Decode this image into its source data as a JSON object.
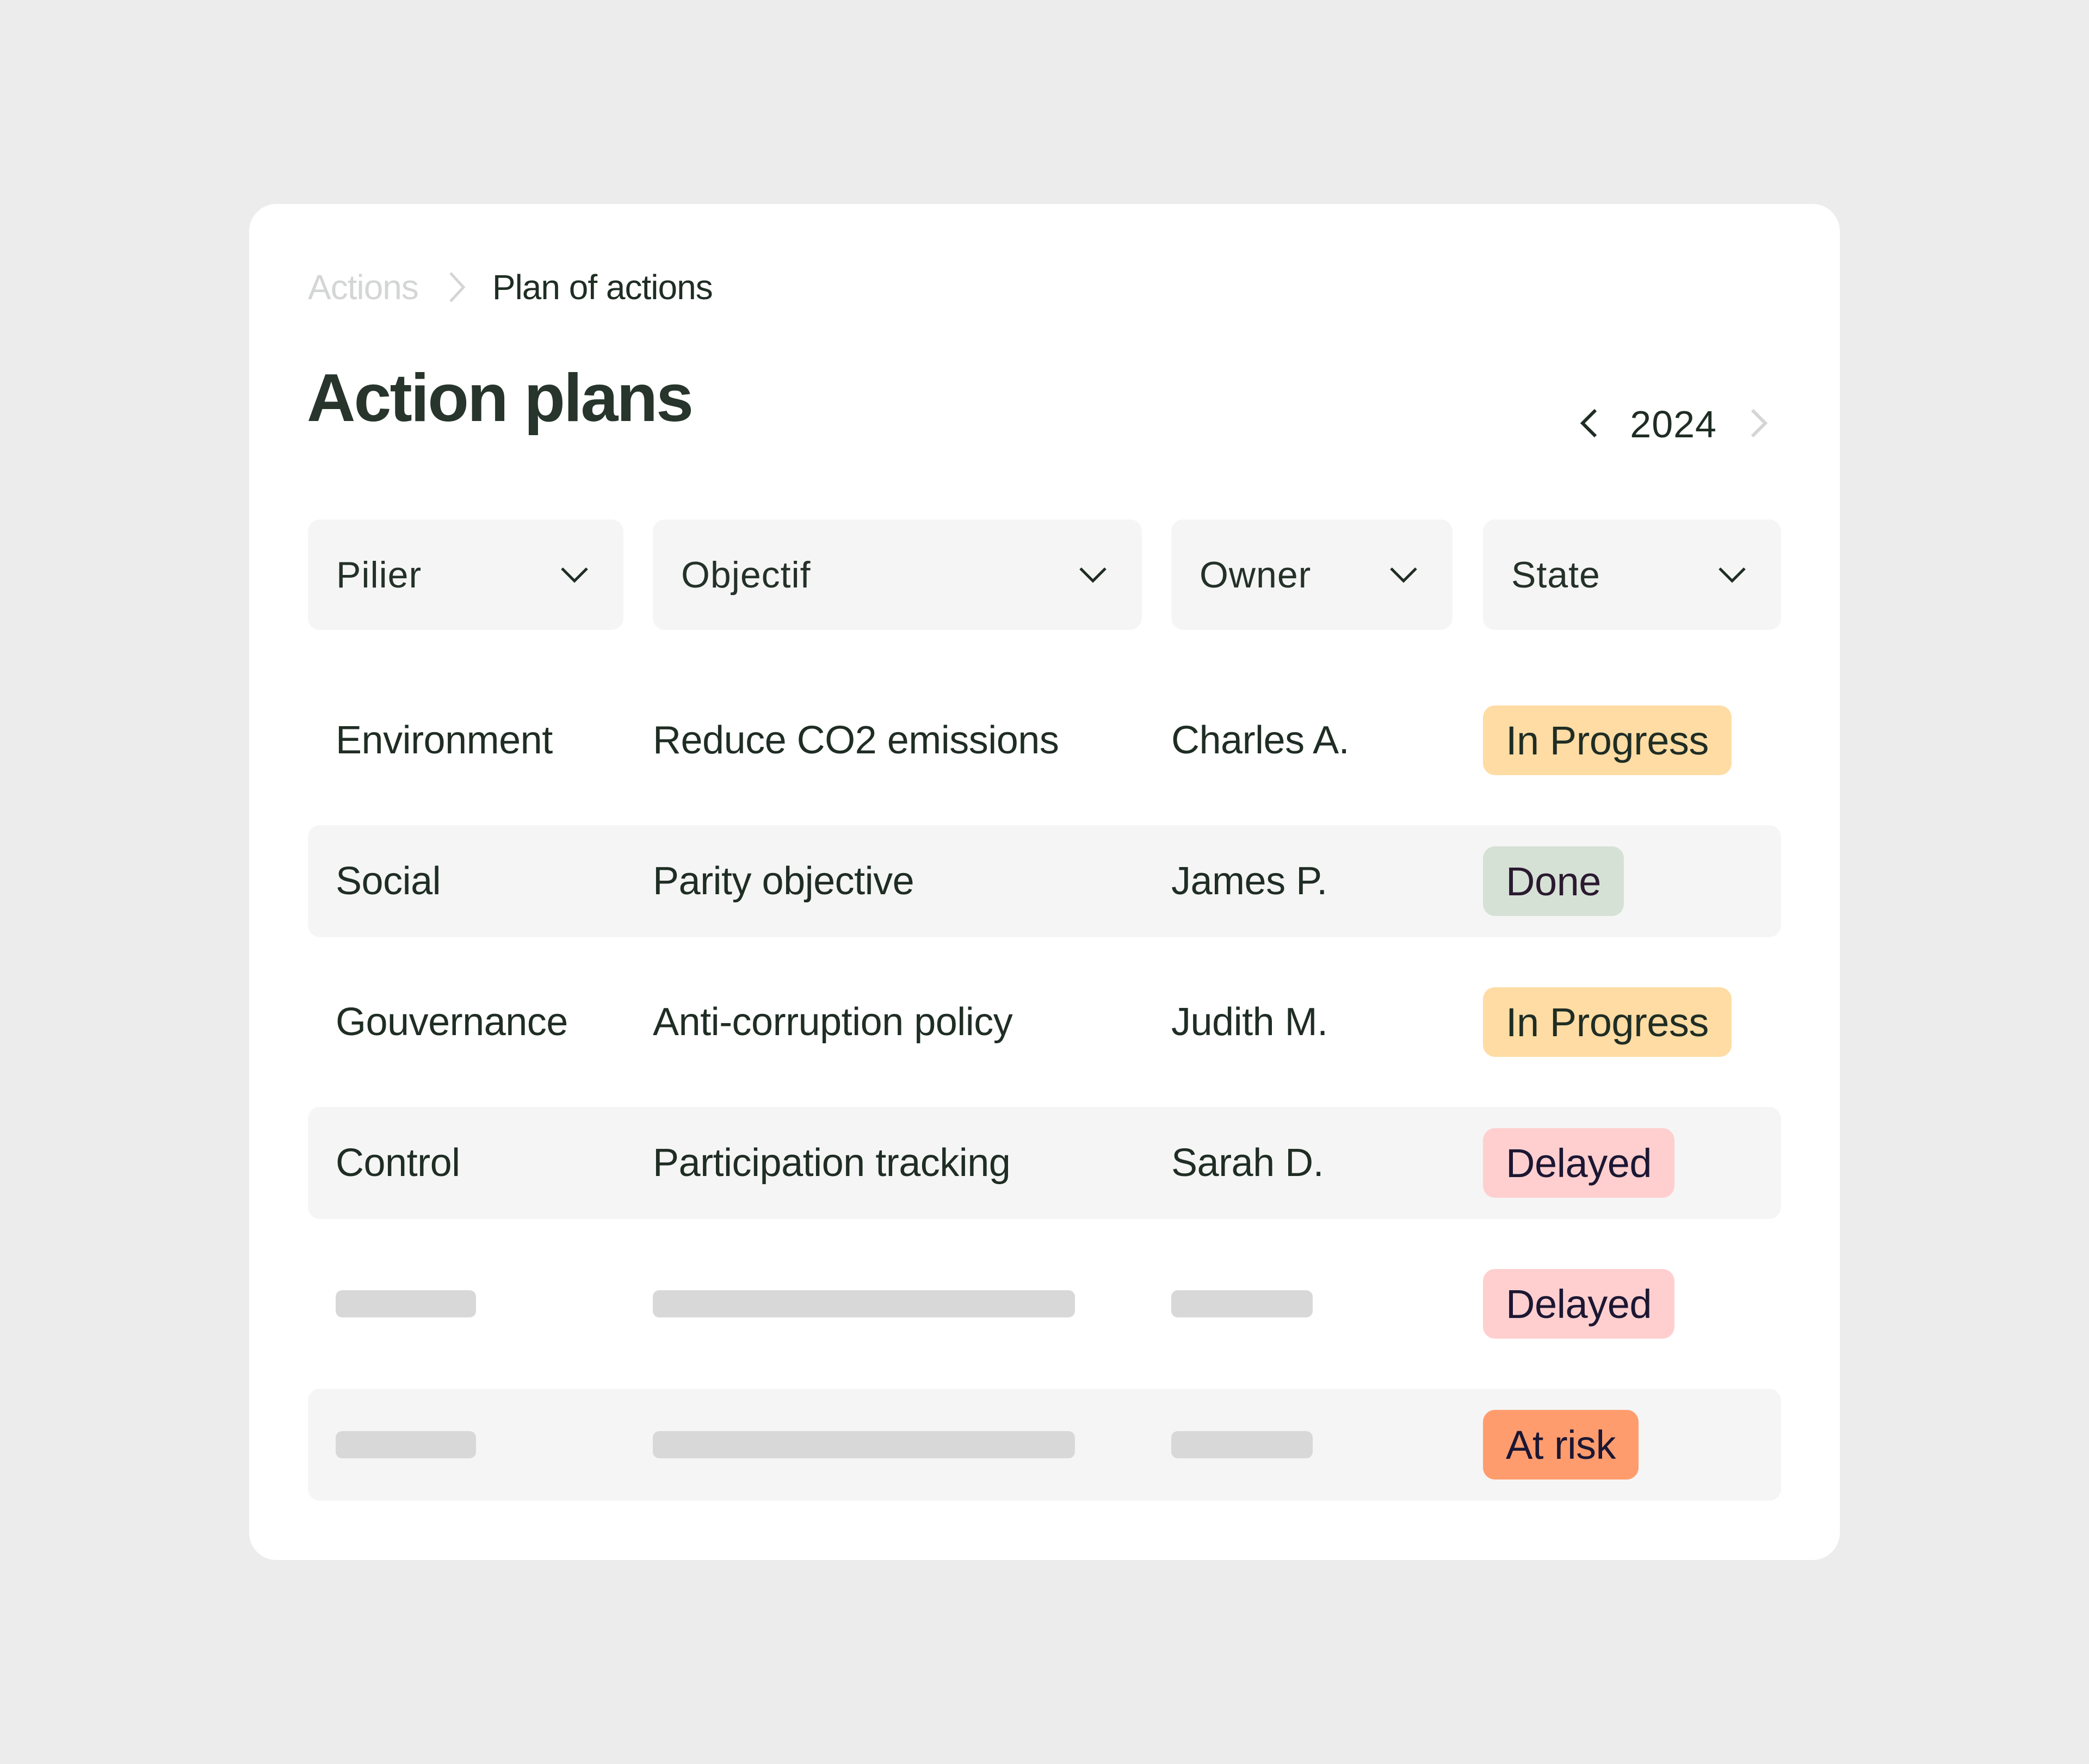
{
  "breadcrumb": {
    "items": [
      "Actions",
      "Plan of actions"
    ]
  },
  "page": {
    "title": "Action plans"
  },
  "year_nav": {
    "year": "2024",
    "prev_icon": "chevron-left-icon",
    "next_icon": "chevron-right-icon"
  },
  "filters": [
    {
      "label": "Pilier",
      "icon": "chevron-down-icon"
    },
    {
      "label": "Objectif",
      "icon": "chevron-down-icon"
    },
    {
      "label": "Owner",
      "icon": "chevron-down-icon"
    },
    {
      "label": "State",
      "icon": "chevron-down-icon"
    }
  ],
  "status_colors": {
    "In Progress": {
      "bg": "#fedca4",
      "fg": "#1f2d24"
    },
    "Done": {
      "bg": "#d6e1d6",
      "fg": "#2a1a30"
    },
    "Delayed": {
      "bg": "#ffcfcf",
      "fg": "#1b1733"
    },
    "At risk": {
      "bg": "#ff9c6e",
      "fg": "#1b1733"
    }
  },
  "rows": [
    {
      "pilier": "Environment",
      "objectif": "Reduce CO2 emissions",
      "owner": "Charles A.",
      "state": "In Progress",
      "placeholder": false
    },
    {
      "pilier": "Social",
      "objectif": "Parity objective",
      "owner": "James P.",
      "state": "Done",
      "placeholder": false
    },
    {
      "pilier": "Gouvernance",
      "objectif": "Anti-corruption policy",
      "owner": "Judith M.",
      "state": "In Progress",
      "placeholder": false
    },
    {
      "pilier": "Control",
      "objectif": "Participation tracking",
      "owner": "Sarah D.",
      "state": "Delayed",
      "placeholder": false
    },
    {
      "pilier": "",
      "objectif": "",
      "owner": "",
      "state": "Delayed",
      "placeholder": true
    },
    {
      "pilier": "",
      "objectif": "",
      "owner": "",
      "state": "At risk",
      "placeholder": true
    }
  ]
}
